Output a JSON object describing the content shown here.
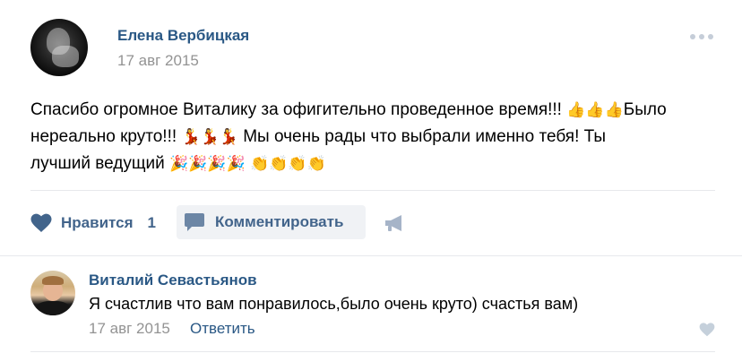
{
  "post": {
    "author": "Елена Вербицкая",
    "date": "17 авг 2015",
    "text_line1": "Спасибо огромное Виталику за офигительно проведенное время!!!",
    "text_line1_tail": "Было",
    "text_line2": "нереально круто!!!",
    "text_line2_tail": " Мы очень рады что выбрали именно тебя! Ты",
    "text_line3": "лучший ведущий",
    "emoji": {
      "thumbs": "👍👍👍",
      "dancers": "💃💃💃",
      "party": "🎉🎉🎉🎉",
      "claps": "👏👏👏👏"
    }
  },
  "actions": {
    "like_label": "Нравится",
    "like_count": "1",
    "comment_label": "Комментировать"
  },
  "comment": {
    "author": "Виталий Севастьянов",
    "text": "Я счастлив что вам понравилось,было очень круто) счастья вам)",
    "date": "17 авг 2015",
    "reply_label": "Ответить"
  },
  "colors": {
    "link": "#2a5885",
    "action": "#42648b",
    "muted": "#939393",
    "button_bg": "#f0f2f5"
  },
  "icons": [
    "more-icon",
    "heart-icon",
    "comment-icon",
    "share-icon"
  ]
}
